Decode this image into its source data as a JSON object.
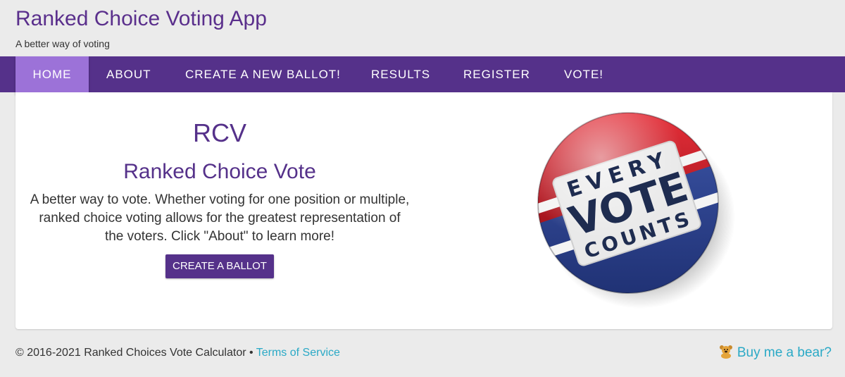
{
  "header": {
    "title": "Ranked Choice Voting App",
    "tagline": "A better way of voting"
  },
  "nav": {
    "items": [
      {
        "label": "HOME"
      },
      {
        "label": "ABOUT"
      },
      {
        "label": "CREATE A NEW BALLOT!"
      },
      {
        "label": "RESULTS"
      },
      {
        "label": "REGISTER"
      },
      {
        "label": "VOTE!"
      }
    ]
  },
  "hero": {
    "abbr": "RCV",
    "title": "Ranked Choice Vote",
    "description": "A better way to vote. Whether voting for one position or multiple, ranked choice voting allows for the greatest representation of the voters. Click \"About\" to learn more!",
    "button_label": "CREATE A BALLOT"
  },
  "badge": {
    "line1": "EVERY",
    "line2": "VOTE",
    "line3": "COUNTS"
  },
  "footer": {
    "copyright": "© 2016-2021 Ranked Choices Vote Calculator • ",
    "tos_label": "Terms of Service",
    "support_label": "Buy me a bear?"
  },
  "colors": {
    "brand": "#55318a",
    "active_tab": "#9c72d8",
    "link": "#2aa9c6"
  }
}
